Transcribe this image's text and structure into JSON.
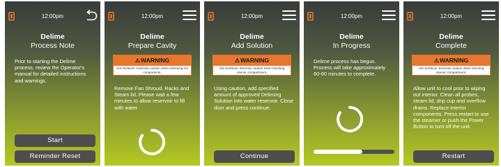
{
  "colors": {
    "warning": "#e8772e",
    "button": "#4e4e4e",
    "gradient_top": "#383c3a",
    "gradient_bottom": "#b5c923"
  },
  "screens": [
    {
      "time": "12:00pm",
      "title": "Delime",
      "subtitle": "Process Note",
      "top_right_icon": "back-arrow-icon",
      "body": "Prior to starting the Delime process, review the Operator's manual for detailed instructions and warnings.",
      "buttons": [
        "Start",
        "Reminder Reset"
      ]
    },
    {
      "time": "12:00pm",
      "title": "Delime",
      "subtitle": "Prepare Cavity",
      "top_right_icon": "hamburger-menu-icon",
      "warning": {
        "label": "WARNING",
        "text": "Hot Surfaces. Exercise caution when removing hot components."
      },
      "body": "Remove Fan Shroud, Racks and Steam lid. Please wait a few minutes to allow reservoir to fill with water.",
      "spinner_icon": "loading-spinner-icon"
    },
    {
      "time": "12:00pm",
      "title": "Delime",
      "subtitle": "Add Solution",
      "top_right_icon": "hamburger-menu-icon",
      "warning": {
        "label": "WARNING",
        "text": "Hot Surfaces. Exercise caution when touching interior compartment."
      },
      "body": "Using caution, add specified amount of approved Deliming Solution into water reservoir. Close door and press continue.",
      "button": "Continue"
    },
    {
      "time": "12:00pm",
      "title": "Delime",
      "subtitle": "In Progress",
      "top_right_icon": "hamburger-menu-icon",
      "body": "Delime process has begun. Process will take approximately 60-90 minutes to complete.",
      "spinner_icon": "loading-spinner-icon",
      "progress": 0.6
    },
    {
      "time": "12:00pm",
      "title": "Delime",
      "subtitle": "Complete",
      "top_right_icon": "hamburger-menu-icon",
      "warning": {
        "label": "WARNING",
        "text": "Hot Surfaces. Exercise caution when touching interior compartment."
      },
      "body": "Allow unit to cool prior to wiping out interior. Clean all probes, steam lid, drip cup and overflow drains. Replace interior components. Press restart to use the steamer or push the Power Button to turn off the unit.",
      "button": "Restart"
    }
  ]
}
